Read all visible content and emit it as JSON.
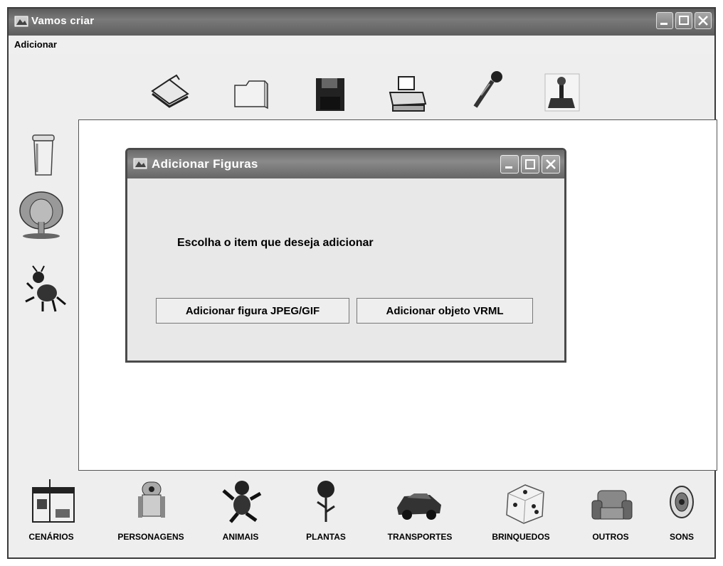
{
  "window": {
    "title": "Vamos criar"
  },
  "menu": {
    "items": [
      "Adicionar"
    ]
  },
  "toolbar": {
    "icons": [
      "new-icon",
      "open-folder-icon",
      "save-icon",
      "print-icon",
      "microphone-icon",
      "joystick-icon"
    ]
  },
  "left_panel": {
    "icons": [
      "trash-can-icon",
      "elephant-icon",
      "ant-icon"
    ]
  },
  "dialog": {
    "title": "Adicionar Figuras",
    "message": "Escolha o item que deseja adicionar",
    "buttons": {
      "jpeg": "Adicionar figura JPEG/GIF",
      "vrml": "Adicionar objeto VRML"
    }
  },
  "categories": [
    "CENÁRIOS",
    "PERSONAGENS",
    "ANIMAIS",
    "PLANTAS",
    "TRANSPORTES",
    "BRINQUEDOS",
    "OUTROS",
    "SONS"
  ],
  "colors": {
    "titlebar": "#5e5e5e",
    "canvas": "#ffffff",
    "window_bg": "#eeeeee"
  }
}
